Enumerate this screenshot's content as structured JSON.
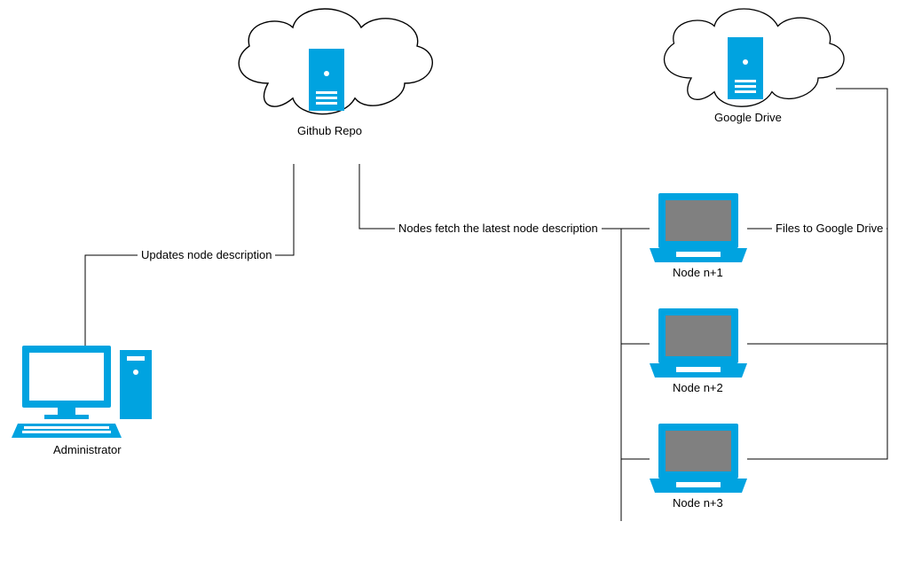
{
  "nodes": {
    "administrator": {
      "label": "Administrator"
    },
    "github_repo": {
      "label": "Github Repo"
    },
    "google_drive": {
      "label": "Google Drive"
    },
    "node1": {
      "label": "Node n+1"
    },
    "node2": {
      "label": "Node n+2"
    },
    "node3": {
      "label": "Node n+3"
    }
  },
  "edges": {
    "admin_to_repo": {
      "label": "Updates node description"
    },
    "repo_to_nodes": {
      "label": "Nodes fetch the latest node description"
    },
    "nodes_to_drive": {
      "label": "Files to Google Drive"
    }
  },
  "colors": {
    "accent": "#00A3E0",
    "screen": "#808080",
    "stroke": "#000000"
  }
}
